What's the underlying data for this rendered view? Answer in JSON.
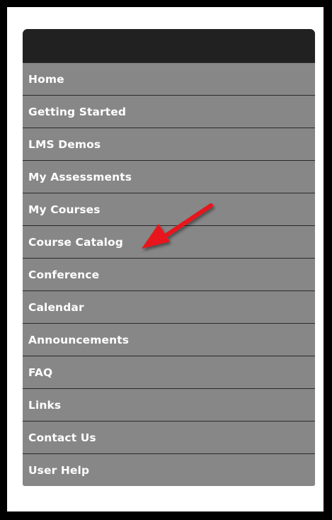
{
  "menu": {
    "items": [
      {
        "label": "Home"
      },
      {
        "label": "Getting Started"
      },
      {
        "label": "LMS Demos"
      },
      {
        "label": "My Assessments"
      },
      {
        "label": "My Courses"
      },
      {
        "label": "Course Catalog"
      },
      {
        "label": "Conference"
      },
      {
        "label": "Calendar"
      },
      {
        "label": "Announcements"
      },
      {
        "label": "FAQ"
      },
      {
        "label": "Links"
      },
      {
        "label": "Contact Us"
      },
      {
        "label": "User Help"
      }
    ]
  },
  "annotation": {
    "arrow_color": "#e8141a",
    "icon": "red-arrow-icon"
  },
  "colors": {
    "header": "#212121",
    "item_bg": "#878787",
    "divider": "#2a2a2a",
    "text": "#ffffff"
  }
}
